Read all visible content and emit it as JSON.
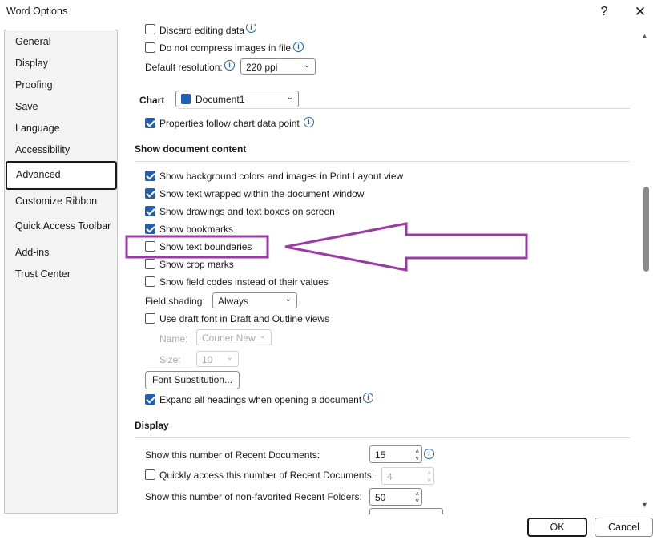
{
  "window": {
    "title": "Word Options",
    "help": "?",
    "close": "✕"
  },
  "nav": {
    "items": [
      "General",
      "Display",
      "Proofing",
      "Save",
      "Language",
      "Accessibility",
      "Advanced",
      "Customize Ribbon",
      "Quick Access Toolbar",
      "Add-ins",
      "Trust Center"
    ],
    "selected": "Advanced"
  },
  "image": {
    "discard_editing": "Discard editing data",
    "no_compress": "Do not compress images in file",
    "resolution_label": "Default resolution:",
    "resolution_value": "220 ppi"
  },
  "chart": {
    "label": "Chart",
    "document": "Document1",
    "follow_point": "Properties follow chart data point"
  },
  "show_content": {
    "heading": "Show document content",
    "items": [
      {
        "label": "Show background colors and images in Print Layout view",
        "checked": true
      },
      {
        "label": "Show text wrapped within the document window",
        "checked": true
      },
      {
        "label": "Show drawings and text boxes on screen",
        "checked": true
      },
      {
        "label": "Show bookmarks",
        "checked": true
      },
      {
        "label": "Show text boundaries",
        "checked": false
      },
      {
        "label": "Show crop marks",
        "checked": false
      },
      {
        "label": "Show field codes instead of their values",
        "checked": false
      }
    ],
    "field_shading_label": "Field shading:",
    "field_shading_value": "Always",
    "draft_font": "Use draft font in Draft and Outline views",
    "name_label": "Name:",
    "name_value": "Courier New",
    "size_label": "Size:",
    "size_value": "10",
    "font_substitution": "Font Substitution...",
    "expand_headings": "Expand all headings when opening a document"
  },
  "display": {
    "heading": "Display",
    "recent_docs_label": "Show this number of Recent Documents:",
    "recent_docs_value": "15",
    "quick_access_label": "Quickly access this number of Recent Documents:",
    "quick_access_value": "4",
    "recent_folders_label": "Show this number of non-favorited Recent Folders:",
    "recent_folders_value": "50"
  },
  "footer": {
    "ok": "OK",
    "cancel": "Cancel"
  },
  "colors": {
    "accent": "#1f5fb4",
    "annotation": "#9b3aa6"
  }
}
